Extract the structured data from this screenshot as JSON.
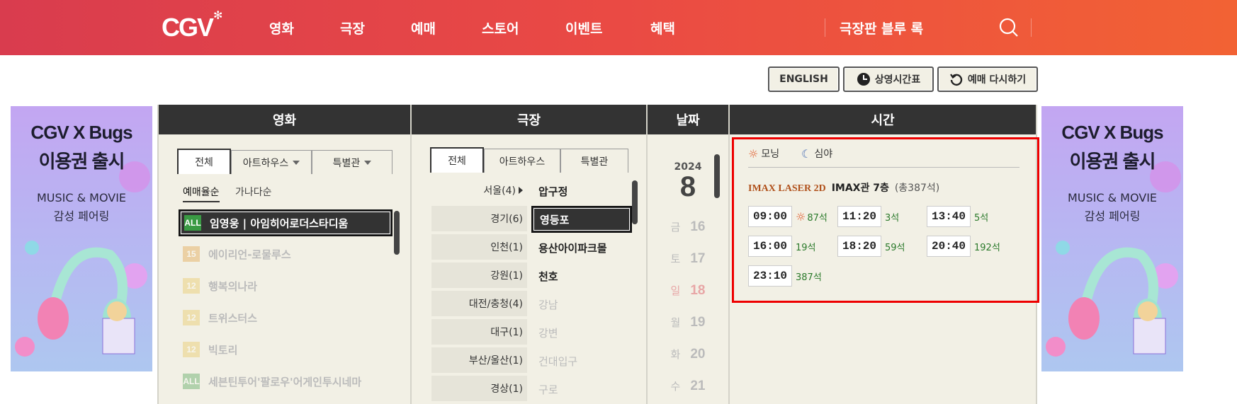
{
  "header": {
    "logo": "CGV",
    "nav": [
      "영화",
      "극장",
      "예매",
      "스토어",
      "이벤트",
      "혜택"
    ],
    "brand_link": "극장판 블루 록"
  },
  "toolbar": {
    "english": "ENGLISH",
    "schedule": "상영시간표",
    "restart": "예매 다시하기"
  },
  "ad": {
    "line1": "CGV X Bugs",
    "line2": "이용권 출시",
    "line3": "MUSIC & MOVIE",
    "line4": "감성 페어링"
  },
  "columns": {
    "movie": "영화",
    "theater": "극장",
    "date": "날짜",
    "time": "시간"
  },
  "movie_panel": {
    "tabs": [
      "전체",
      "아트하우스",
      "특별관"
    ],
    "sorts": [
      "예매율순",
      "가나다순"
    ],
    "items": [
      {
        "rating": "ALL",
        "title": "임영웅 | 아임히어로더스타디움"
      },
      {
        "rating": "15",
        "title": "에이리언-로물루스"
      },
      {
        "rating": "12",
        "title": "행복의나라"
      },
      {
        "rating": "12",
        "title": "트위스터스"
      },
      {
        "rating": "12",
        "title": "빅토리"
      },
      {
        "rating": "ALL",
        "title": "세븐틴투어'팔로우'어게인투시네마"
      }
    ]
  },
  "theater_panel": {
    "tabs": [
      "전체",
      "아트하우스",
      "특별관"
    ],
    "regions": [
      "서울(4)",
      "경기(6)",
      "인천(1)",
      "강원(1)",
      "대전/충청(4)",
      "대구(1)",
      "부산/울산(1)",
      "경상(1)"
    ],
    "theaters": [
      "압구정",
      "영등포",
      "용산아이파크몰",
      "천호",
      "강남",
      "강변",
      "건대입구",
      "구로"
    ]
  },
  "date_panel": {
    "year": "2024",
    "month": "8",
    "days": [
      {
        "dow": "금",
        "num": "16"
      },
      {
        "dow": "토",
        "num": "17"
      },
      {
        "dow": "일",
        "num": "18"
      },
      {
        "dow": "월",
        "num": "19"
      },
      {
        "dow": "화",
        "num": "20"
      },
      {
        "dow": "수",
        "num": "21"
      }
    ]
  },
  "time_panel": {
    "legend_morning": "모닝",
    "legend_night": "심야",
    "format": "IMAX LASER 2D",
    "hall": "IMAX관 7층",
    "total": "(총387석)",
    "slots": [
      {
        "time": "09:00",
        "seats": "87석",
        "morning": true
      },
      {
        "time": "11:20",
        "seats": "3석",
        "morning": false
      },
      {
        "time": "13:40",
        "seats": "5석",
        "morning": false
      },
      {
        "time": "16:00",
        "seats": "19석",
        "morning": false
      },
      {
        "time": "18:20",
        "seats": "59석",
        "morning": false
      },
      {
        "time": "20:40",
        "seats": "192석",
        "morning": false
      },
      {
        "time": "23:10",
        "seats": "387석",
        "morning": false
      }
    ]
  },
  "colors": {
    "header_start": "#d93c4e",
    "header_end": "#f26234",
    "panel_bg": "#f2f0e5",
    "highlight_border": "#e00000",
    "seat_green": "#2b7a2b",
    "format_orange": "#b0501a"
  }
}
